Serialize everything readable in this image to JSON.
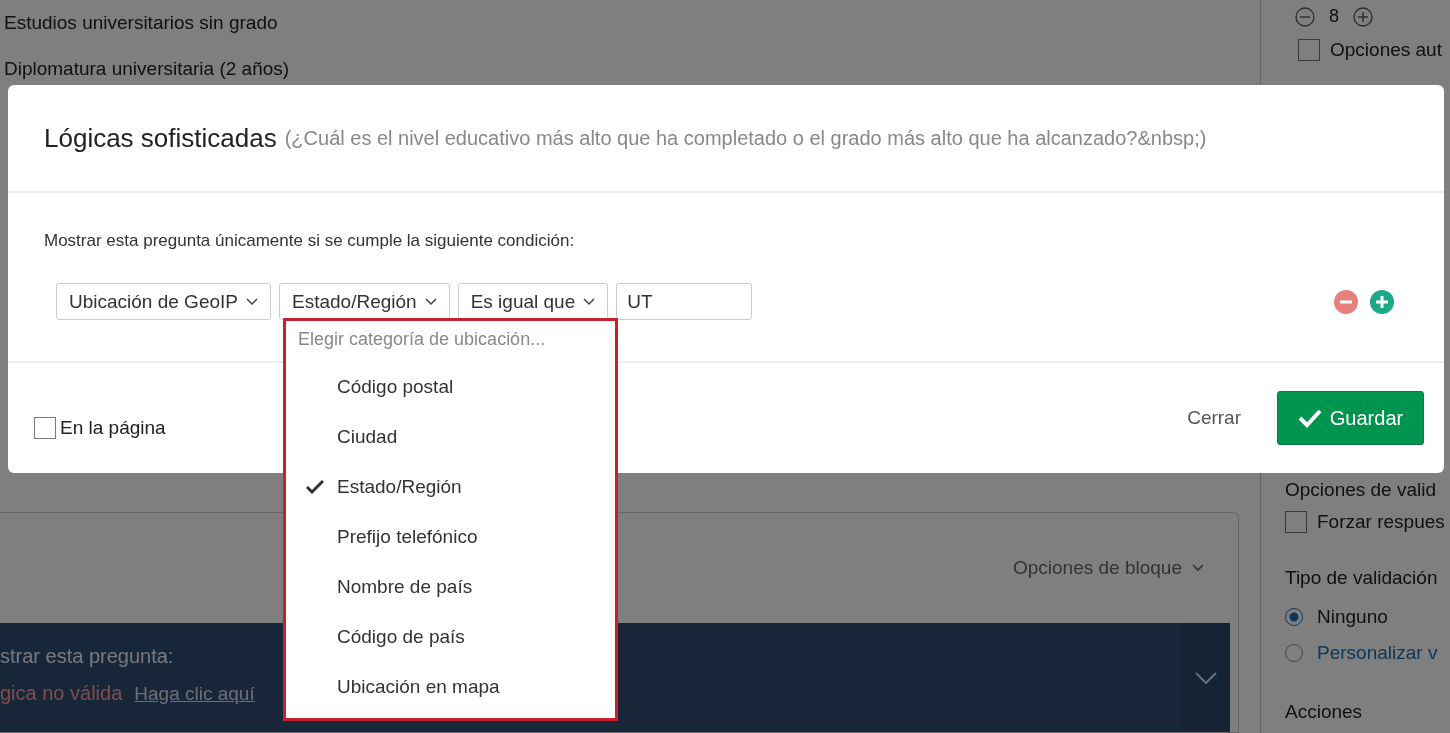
{
  "background": {
    "answer_choices": [
      "Estudios universitarios sin grado",
      "Diplomatura universitaria (2 años)"
    ],
    "stepper": {
      "value": "8"
    },
    "auto_options": {
      "label": "Opciones aut",
      "checked": false
    },
    "block_options": "Opciones de bloque",
    "display_logic": {
      "title": "strar esta pregunta:",
      "error": "gica no válida",
      "link": "Haga clic aquí"
    },
    "side_panel": {
      "validation_heading": "Opciones de valid",
      "force_response": {
        "label": "Forzar respues",
        "checked": false
      },
      "validation_type_label": "Tipo de validación",
      "validation_types": [
        {
          "label": "Ninguno",
          "selected": true
        },
        {
          "label": "Personalizar v",
          "selected": false
        }
      ],
      "actions_heading": "Acciones"
    }
  },
  "dialog": {
    "title": "Lógicas sofisticadas",
    "question": "(¿Cuál es el nivel educativo más alto que ha completado o el grado más alto que ha alcanzado?&nbsp;)",
    "instruction": "Mostrar esta pregunta únicamente si se cumple la siguiente condición:",
    "condition": {
      "selects": [
        "Ubicación de GeoIP",
        "Estado/Región",
        "Es igual que"
      ],
      "value": "UT"
    },
    "on_page": {
      "label": "En la página",
      "checked": false
    },
    "buttons": {
      "close": "Cerrar",
      "save": "Guardar"
    }
  },
  "dropdown": {
    "placeholder": "Elegir categoría de ubicación...",
    "options": [
      {
        "label": "Código postal",
        "selected": false
      },
      {
        "label": "Ciudad",
        "selected": false
      },
      {
        "label": "Estado/Región",
        "selected": true
      },
      {
        "label": "Prefijo telefónico",
        "selected": false
      },
      {
        "label": "Nombre de país",
        "selected": false
      },
      {
        "label": "Código de país",
        "selected": false
      },
      {
        "label": "Ubicación en mapa",
        "selected": false
      }
    ]
  }
}
